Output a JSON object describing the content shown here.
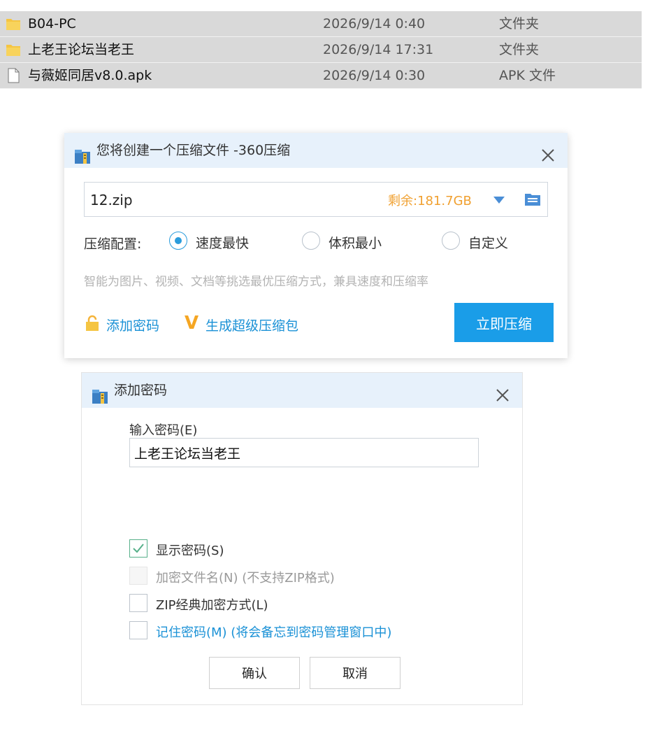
{
  "files": [
    {
      "icon": "folder-icon",
      "name": "B04-PC",
      "date": "2026/9/14 0:40",
      "type": "文件夹"
    },
    {
      "icon": "folder-icon",
      "name": "上老王论坛当老王",
      "date": "2026/9/14 17:31",
      "type": "文件夹"
    },
    {
      "icon": "file-icon",
      "name": "与薇姬同居v8.0.apk",
      "date": "2026/9/14 0:30",
      "type": "APK 文件"
    }
  ],
  "compress_dialog": {
    "title": "您将创建一个压缩文件 -360压缩",
    "filename": "12.zip",
    "free_space": "剩余:181.7GB",
    "config_label": "压缩配置:",
    "options": [
      "速度最快",
      "体积最小",
      "自定义"
    ],
    "selected_option": "速度最快",
    "hint": "智能为图片、视频、文档等挑选最优压缩方式，兼具速度和压缩率",
    "add_password": "添加密码",
    "super_v": "V",
    "super_pack": "生成超级压缩包",
    "compress_now": "立即压缩"
  },
  "password_dialog": {
    "title": "添加密码",
    "input_label": "输入密码(E)",
    "password_value": "上老王论坛当老王",
    "checkboxes": [
      {
        "label": "显示密码(S)",
        "checked": true,
        "disabled": false
      },
      {
        "label": "加密文件名(N) (不支持ZIP格式)",
        "checked": false,
        "disabled": true
      },
      {
        "label": "ZIP经典加密方式(L)",
        "checked": false,
        "disabled": false
      },
      {
        "label": "记住密码(M) (将会备忘到密码管理窗口中)",
        "checked": false,
        "disabled": false
      }
    ],
    "ok": "确认",
    "cancel": "取消"
  },
  "colors": {
    "accent": "#1a9de8",
    "link": "#1a91d6",
    "free_space": "#f0a030",
    "title_bar": "#e7f1fb",
    "file_row": "#d9d9d9"
  }
}
